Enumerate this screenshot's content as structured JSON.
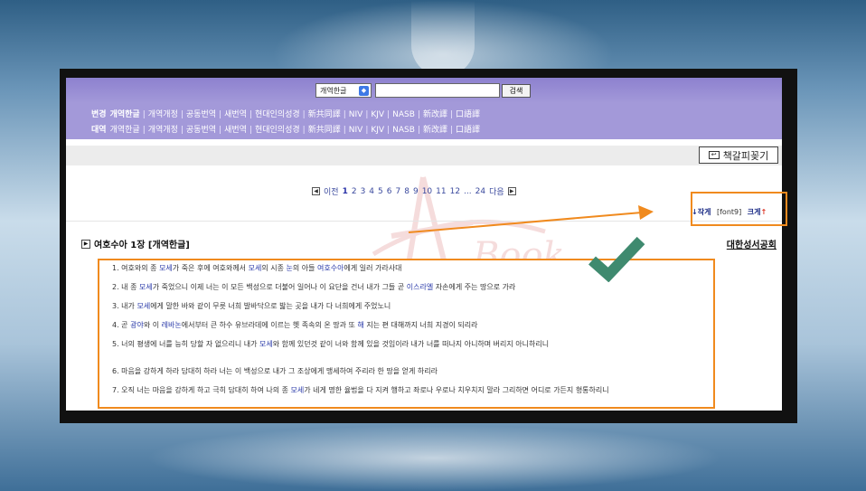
{
  "search": {
    "select_value": "개역한글",
    "button_label": "검색"
  },
  "versions": {
    "row1": {
      "lead": "변경",
      "items": [
        "개역한글",
        "개역개정",
        "공동번역",
        "새번역",
        "현대인의성경",
        "新共同譯",
        "NIV",
        "KJV",
        "NASB",
        "新改譯",
        "口語譯"
      ],
      "selected": 0
    },
    "row2": {
      "lead": "대역",
      "items": [
        "개역한글",
        "개역개정",
        "공동번역",
        "새번역",
        "현대인의성경",
        "新共同譯",
        "NIV",
        "KJV",
        "NASB",
        "新改譯",
        "口語譯"
      ]
    }
  },
  "toolbar": {
    "bookmark_label": "책갈피꽂기"
  },
  "pager": {
    "prev": "이전",
    "current": "1",
    "pages": [
      "2",
      "3",
      "4",
      "5",
      "6",
      "7",
      "8",
      "9",
      "10",
      "11",
      "12",
      "...",
      "24"
    ],
    "next": "다음"
  },
  "font_size": {
    "smaller": "↓작게",
    "current": "[font9]",
    "bigger": "크게",
    "bigger_arrow": "↑"
  },
  "chapter": {
    "title": "여호수아 1장 [개역한글]",
    "publisher": "대한성서공회"
  },
  "verses": [
    [
      {
        "t": "1. 여호와의 종 "
      },
      {
        "t": "모세",
        "hl": true
      },
      {
        "t": "가 죽은 후에 여호와께서 "
      },
      {
        "t": "모세",
        "hl": true
      },
      {
        "t": "의 시종 "
      },
      {
        "t": "눈",
        "hl": true
      },
      {
        "t": "의 아들 "
      },
      {
        "t": "여호수아",
        "hl": true
      },
      {
        "t": "에게 일러 가라사대"
      }
    ],
    [
      {
        "t": "2. 내 종 "
      },
      {
        "t": "모세",
        "hl": true
      },
      {
        "t": "가 죽었으니 이제 너는 이 모든 백성으로 더불어 일어나 이 요단을 건너 내가 그들 곧 "
      },
      {
        "t": "이스라엘",
        "hl": true
      },
      {
        "t": " 자손에게 주는 땅으로 가라"
      }
    ],
    [
      {
        "t": "3. 내가 "
      },
      {
        "t": "모세",
        "hl": true
      },
      {
        "t": "에게 말한 바와 같이 무릇 너희 발바닥으로 밟는 곳을 내가 다 너희에게 주었노니"
      }
    ],
    [
      {
        "t": "4. 곧 "
      },
      {
        "t": "광야",
        "hl": true
      },
      {
        "t": "와 이 "
      },
      {
        "t": "레바논",
        "hl": true
      },
      {
        "t": "에서부터 큰 하수 유브라데에 이르는 헷 족속의 온 땅과 또 "
      },
      {
        "t": "해",
        "hl": true
      },
      {
        "t": " 지는 편 대해까지 너희 지경이 되리라"
      }
    ],
    [
      {
        "t": "5. 너의 평생에 너를 능히 당할 자 없으리니 내가 "
      },
      {
        "t": "모세",
        "hl": true
      },
      {
        "t": "와 함께 있던것 같이 너와 함께 있을 것임이라 내가 너를 떠나지 아니하며 버리지 아니하리니"
      }
    ],
    [
      {
        "t": "6. 마음을 강하게 하라 담대히 하라 너는 이 백성으로 내가 그 조상에게 맹세하여 주리라 한 땅을 얻게 하리라"
      }
    ],
    [
      {
        "t": "7. 오직 너는 마음을 강하게 하고 극히 담대히 하여 나의 종 "
      },
      {
        "t": "모세",
        "hl": true
      },
      {
        "t": "가 네게 명한 율법을 다 지켜 행하고 좌로나 우로나 치우치지 말라 그리하면 어디로 가든지 형통하리니"
      }
    ]
  ],
  "colors": {
    "annotation": "#f08a1e",
    "checkmark": "#3f8a6f",
    "purple_bar": "#a399d9",
    "highlight_text": "#2a3aa9"
  },
  "watermark_text": "Book"
}
